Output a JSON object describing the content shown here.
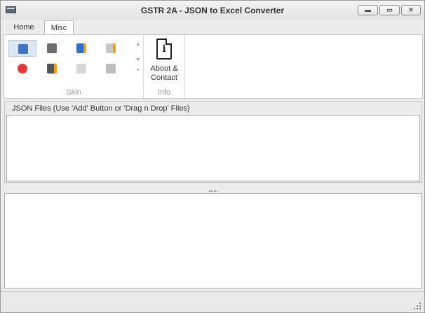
{
  "window": {
    "title": "GSTR 2A - JSON to Excel Converter",
    "min_glyph": "▬",
    "max_glyph": "▭",
    "close_glyph": "✕"
  },
  "tabs": [
    {
      "label": "Home",
      "active": false
    },
    {
      "label": "Misc",
      "active": true
    }
  ],
  "ribbon": {
    "skin_group": {
      "label": "Skin",
      "gallery_up": "▲",
      "gallery_down": "▼",
      "gallery_more": "▾",
      "icons": [
        {
          "name": "skin-office-blue-icon",
          "color": "#3f74c6",
          "selected": true
        },
        {
          "name": "skin-office-gray-icon",
          "color": "#6e6e6e",
          "selected": false
        },
        {
          "name": "skin-office-2016-icon",
          "color": "#2f6fd0",
          "selected": false
        },
        {
          "name": "skin-office-light-icon",
          "color": "#c8c8c8",
          "selected": false
        },
        {
          "name": "skin-red-icon",
          "color": "#e03a3a",
          "selected": false
        },
        {
          "name": "skin-office-dark-icon",
          "color": "#555555",
          "selected": false
        },
        {
          "name": "skin-office-faded-icon",
          "color": "#d6d6d6",
          "selected": false
        },
        {
          "name": "skin-office-white-icon",
          "color": "#bdbdbd",
          "selected": false
        }
      ]
    },
    "info_group": {
      "label": "Info",
      "about_line1": "About &",
      "about_line2": "Contact",
      "icon": "info-document-icon"
    }
  },
  "files_panel": {
    "header": "JSON Files (Use 'Add' Button or 'Drag n Drop' Files)",
    "items": []
  },
  "log_area": {
    "text": ""
  }
}
